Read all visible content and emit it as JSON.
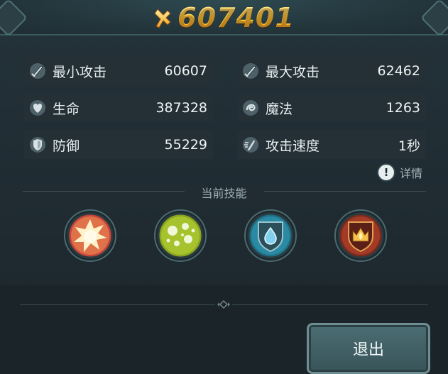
{
  "combat_power": {
    "value": "607401"
  },
  "stats": [
    {
      "label": "最小攻击",
      "value": "60607",
      "icon": "sword-icon"
    },
    {
      "label": "最大攻击",
      "value": "62462",
      "icon": "sword-icon"
    },
    {
      "label": "生命",
      "value": "387328",
      "icon": "heart-icon"
    },
    {
      "label": "魔法",
      "value": "1263",
      "icon": "magic-swirl-icon"
    },
    {
      "label": "防御",
      "value": "55229",
      "icon": "shield-icon"
    },
    {
      "label": "攻击速度",
      "value": "1秒",
      "icon": "speed-icon"
    }
  ],
  "details_label": "详情",
  "skills": {
    "title": "当前技能",
    "items": [
      {
        "icon": "explosion-skill-icon"
      },
      {
        "icon": "poison-bubbles-skill-icon"
      },
      {
        "icon": "water-drop-skill-icon"
      },
      {
        "icon": "fire-crown-skill-icon"
      }
    ]
  },
  "exit_label": "退出",
  "colors": {
    "power_gold": "#ffcf3a",
    "panel_bg": "#1f2a2e",
    "stat_bg": "#243036",
    "button_bg": "#4b6d73"
  }
}
